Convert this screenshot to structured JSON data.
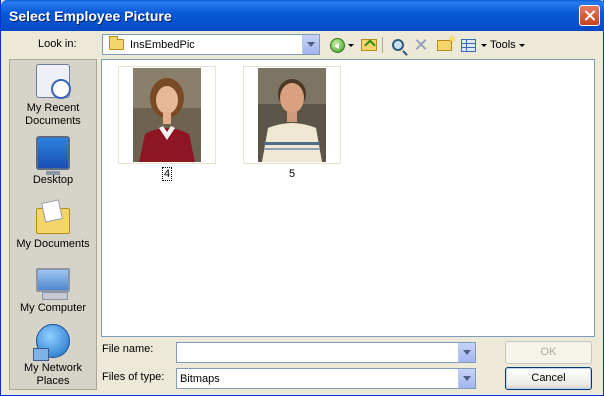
{
  "window": {
    "title": "Select Employee Picture"
  },
  "toolbar": {
    "look_in_label": "Look in:",
    "look_in_value": "InsEmbedPic",
    "tools_label": "Tools"
  },
  "places": [
    {
      "id": "recent",
      "label_line1": "My Recent",
      "label_line2": "Documents",
      "icon": "recent-documents-icon"
    },
    {
      "id": "desktop",
      "label_line1": "Desktop",
      "label_line2": "",
      "icon": "desktop-icon"
    },
    {
      "id": "documents",
      "label_line1": "My Documents",
      "label_line2": "",
      "icon": "my-documents-icon"
    },
    {
      "id": "computer",
      "label_line1": "My Computer",
      "label_line2": "",
      "icon": "my-computer-icon"
    },
    {
      "id": "network",
      "label_line1": "My Network",
      "label_line2": "Places",
      "icon": "network-places-icon"
    }
  ],
  "files": [
    {
      "name": "4",
      "subject": "woman",
      "focused": true
    },
    {
      "name": "5",
      "subject": "man",
      "focused": false
    }
  ],
  "form": {
    "file_name_label": "File name:",
    "file_name_value": "",
    "file_type_label": "Files of type:",
    "file_type_value": "Bitmaps"
  },
  "buttons": {
    "ok": "OK",
    "cancel": "Cancel"
  }
}
